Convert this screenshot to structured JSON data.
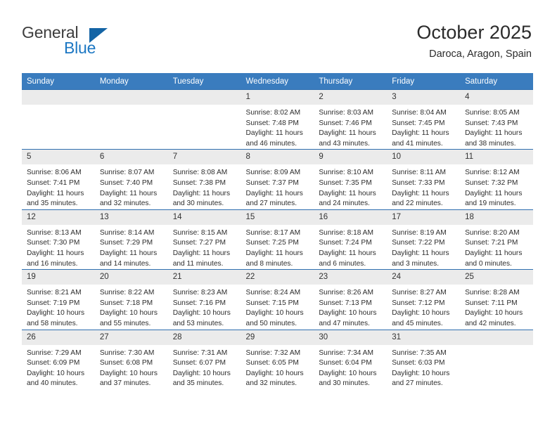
{
  "brand": {
    "name_top": "General",
    "name_bottom": "Blue",
    "accent_color": "#1c77c3",
    "triangle_color": "#1464a5"
  },
  "header": {
    "title": "October 2025",
    "subtitle": "Daroca, Aragon, Spain"
  },
  "theme": {
    "header_row_bg": "#3a7cbe",
    "daynum_bg": "#ebebeb",
    "row_border": "#2f6fb0",
    "text": "#2d2d2d"
  },
  "calendar": {
    "weekday_headers": [
      "Sunday",
      "Monday",
      "Tuesday",
      "Wednesday",
      "Thursday",
      "Friday",
      "Saturday"
    ],
    "weeks": [
      [
        {
          "day": "",
          "empty": true,
          "sunrise": "",
          "sunset": "",
          "daylight_1": "",
          "daylight_2": ""
        },
        {
          "day": "",
          "empty": true,
          "sunrise": "",
          "sunset": "",
          "daylight_1": "",
          "daylight_2": ""
        },
        {
          "day": "",
          "empty": true,
          "sunrise": "",
          "sunset": "",
          "daylight_1": "",
          "daylight_2": ""
        },
        {
          "day": "1",
          "empty": false,
          "sunrise": "Sunrise: 8:02 AM",
          "sunset": "Sunset: 7:48 PM",
          "daylight_1": "Daylight: 11 hours",
          "daylight_2": "and 46 minutes."
        },
        {
          "day": "2",
          "empty": false,
          "sunrise": "Sunrise: 8:03 AM",
          "sunset": "Sunset: 7:46 PM",
          "daylight_1": "Daylight: 11 hours",
          "daylight_2": "and 43 minutes."
        },
        {
          "day": "3",
          "empty": false,
          "sunrise": "Sunrise: 8:04 AM",
          "sunset": "Sunset: 7:45 PM",
          "daylight_1": "Daylight: 11 hours",
          "daylight_2": "and 41 minutes."
        },
        {
          "day": "4",
          "empty": false,
          "sunrise": "Sunrise: 8:05 AM",
          "sunset": "Sunset: 7:43 PM",
          "daylight_1": "Daylight: 11 hours",
          "daylight_2": "and 38 minutes."
        }
      ],
      [
        {
          "day": "5",
          "empty": false,
          "sunrise": "Sunrise: 8:06 AM",
          "sunset": "Sunset: 7:41 PM",
          "daylight_1": "Daylight: 11 hours",
          "daylight_2": "and 35 minutes."
        },
        {
          "day": "6",
          "empty": false,
          "sunrise": "Sunrise: 8:07 AM",
          "sunset": "Sunset: 7:40 PM",
          "daylight_1": "Daylight: 11 hours",
          "daylight_2": "and 32 minutes."
        },
        {
          "day": "7",
          "empty": false,
          "sunrise": "Sunrise: 8:08 AM",
          "sunset": "Sunset: 7:38 PM",
          "daylight_1": "Daylight: 11 hours",
          "daylight_2": "and 30 minutes."
        },
        {
          "day": "8",
          "empty": false,
          "sunrise": "Sunrise: 8:09 AM",
          "sunset": "Sunset: 7:37 PM",
          "daylight_1": "Daylight: 11 hours",
          "daylight_2": "and 27 minutes."
        },
        {
          "day": "9",
          "empty": false,
          "sunrise": "Sunrise: 8:10 AM",
          "sunset": "Sunset: 7:35 PM",
          "daylight_1": "Daylight: 11 hours",
          "daylight_2": "and 24 minutes."
        },
        {
          "day": "10",
          "empty": false,
          "sunrise": "Sunrise: 8:11 AM",
          "sunset": "Sunset: 7:33 PM",
          "daylight_1": "Daylight: 11 hours",
          "daylight_2": "and 22 minutes."
        },
        {
          "day": "11",
          "empty": false,
          "sunrise": "Sunrise: 8:12 AM",
          "sunset": "Sunset: 7:32 PM",
          "daylight_1": "Daylight: 11 hours",
          "daylight_2": "and 19 minutes."
        }
      ],
      [
        {
          "day": "12",
          "empty": false,
          "sunrise": "Sunrise: 8:13 AM",
          "sunset": "Sunset: 7:30 PM",
          "daylight_1": "Daylight: 11 hours",
          "daylight_2": "and 16 minutes."
        },
        {
          "day": "13",
          "empty": false,
          "sunrise": "Sunrise: 8:14 AM",
          "sunset": "Sunset: 7:29 PM",
          "daylight_1": "Daylight: 11 hours",
          "daylight_2": "and 14 minutes."
        },
        {
          "day": "14",
          "empty": false,
          "sunrise": "Sunrise: 8:15 AM",
          "sunset": "Sunset: 7:27 PM",
          "daylight_1": "Daylight: 11 hours",
          "daylight_2": "and 11 minutes."
        },
        {
          "day": "15",
          "empty": false,
          "sunrise": "Sunrise: 8:17 AM",
          "sunset": "Sunset: 7:25 PM",
          "daylight_1": "Daylight: 11 hours",
          "daylight_2": "and 8 minutes."
        },
        {
          "day": "16",
          "empty": false,
          "sunrise": "Sunrise: 8:18 AM",
          "sunset": "Sunset: 7:24 PM",
          "daylight_1": "Daylight: 11 hours",
          "daylight_2": "and 6 minutes."
        },
        {
          "day": "17",
          "empty": false,
          "sunrise": "Sunrise: 8:19 AM",
          "sunset": "Sunset: 7:22 PM",
          "daylight_1": "Daylight: 11 hours",
          "daylight_2": "and 3 minutes."
        },
        {
          "day": "18",
          "empty": false,
          "sunrise": "Sunrise: 8:20 AM",
          "sunset": "Sunset: 7:21 PM",
          "daylight_1": "Daylight: 11 hours",
          "daylight_2": "and 0 minutes."
        }
      ],
      [
        {
          "day": "19",
          "empty": false,
          "sunrise": "Sunrise: 8:21 AM",
          "sunset": "Sunset: 7:19 PM",
          "daylight_1": "Daylight: 10 hours",
          "daylight_2": "and 58 minutes."
        },
        {
          "day": "20",
          "empty": false,
          "sunrise": "Sunrise: 8:22 AM",
          "sunset": "Sunset: 7:18 PM",
          "daylight_1": "Daylight: 10 hours",
          "daylight_2": "and 55 minutes."
        },
        {
          "day": "21",
          "empty": false,
          "sunrise": "Sunrise: 8:23 AM",
          "sunset": "Sunset: 7:16 PM",
          "daylight_1": "Daylight: 10 hours",
          "daylight_2": "and 53 minutes."
        },
        {
          "day": "22",
          "empty": false,
          "sunrise": "Sunrise: 8:24 AM",
          "sunset": "Sunset: 7:15 PM",
          "daylight_1": "Daylight: 10 hours",
          "daylight_2": "and 50 minutes."
        },
        {
          "day": "23",
          "empty": false,
          "sunrise": "Sunrise: 8:26 AM",
          "sunset": "Sunset: 7:13 PM",
          "daylight_1": "Daylight: 10 hours",
          "daylight_2": "and 47 minutes."
        },
        {
          "day": "24",
          "empty": false,
          "sunrise": "Sunrise: 8:27 AM",
          "sunset": "Sunset: 7:12 PM",
          "daylight_1": "Daylight: 10 hours",
          "daylight_2": "and 45 minutes."
        },
        {
          "day": "25",
          "empty": false,
          "sunrise": "Sunrise: 8:28 AM",
          "sunset": "Sunset: 7:11 PM",
          "daylight_1": "Daylight: 10 hours",
          "daylight_2": "and 42 minutes."
        }
      ],
      [
        {
          "day": "26",
          "empty": false,
          "sunrise": "Sunrise: 7:29 AM",
          "sunset": "Sunset: 6:09 PM",
          "daylight_1": "Daylight: 10 hours",
          "daylight_2": "and 40 minutes."
        },
        {
          "day": "27",
          "empty": false,
          "sunrise": "Sunrise: 7:30 AM",
          "sunset": "Sunset: 6:08 PM",
          "daylight_1": "Daylight: 10 hours",
          "daylight_2": "and 37 minutes."
        },
        {
          "day": "28",
          "empty": false,
          "sunrise": "Sunrise: 7:31 AM",
          "sunset": "Sunset: 6:07 PM",
          "daylight_1": "Daylight: 10 hours",
          "daylight_2": "and 35 minutes."
        },
        {
          "day": "29",
          "empty": false,
          "sunrise": "Sunrise: 7:32 AM",
          "sunset": "Sunset: 6:05 PM",
          "daylight_1": "Daylight: 10 hours",
          "daylight_2": "and 32 minutes."
        },
        {
          "day": "30",
          "empty": false,
          "sunrise": "Sunrise: 7:34 AM",
          "sunset": "Sunset: 6:04 PM",
          "daylight_1": "Daylight: 10 hours",
          "daylight_2": "and 30 minutes."
        },
        {
          "day": "31",
          "empty": false,
          "sunrise": "Sunrise: 7:35 AM",
          "sunset": "Sunset: 6:03 PM",
          "daylight_1": "Daylight: 10 hours",
          "daylight_2": "and 27 minutes."
        },
        {
          "day": "",
          "empty": true,
          "sunrise": "",
          "sunset": "",
          "daylight_1": "",
          "daylight_2": ""
        }
      ]
    ]
  }
}
